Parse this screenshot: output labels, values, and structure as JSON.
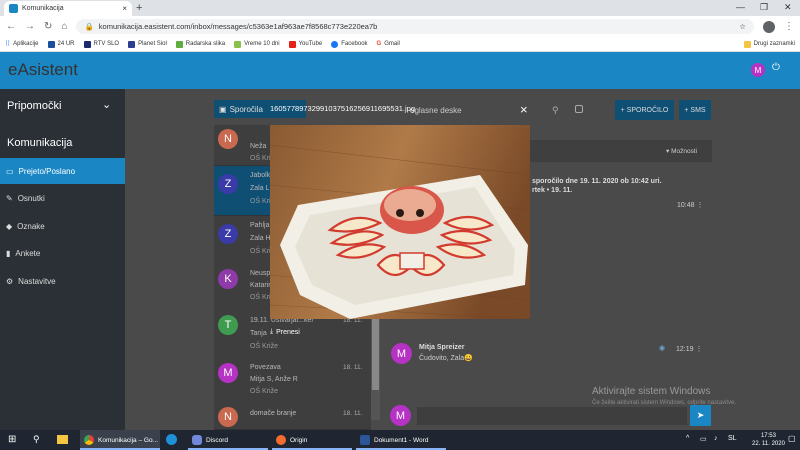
{
  "browser": {
    "tab_title": "Komunikacija",
    "new_tab": "+",
    "url": "komunikacija.easistent.com/inbox/messages/c5363e1af963ae7f8568c773e220ea7b",
    "bookmarks": [
      "Aplikacije",
      "24 UR",
      "RTV SLO",
      "Planet Siol",
      "Radarska slika",
      "Vreme 10 dni",
      "YouTube",
      "Facebook",
      "Gmail"
    ],
    "other_bookmarks": "Drugi zaznamki"
  },
  "app": {
    "logo": "eAsistent",
    "avatar_letter": "M",
    "colors": {
      "header": "#1a87c4",
      "sidebar": "#2a3036",
      "avatar": "#b532c4"
    }
  },
  "sidebar": {
    "section1": "Pripomočki",
    "section2": "Komunikacija",
    "items": [
      {
        "label": "Prejeto/Poslano",
        "icon": "inbox-icon",
        "active": true
      },
      {
        "label": "Osnutki",
        "icon": "pencil-icon"
      },
      {
        "label": "Oznake",
        "icon": "tag-icon"
      },
      {
        "label": "Ankete",
        "icon": "poll-icon"
      },
      {
        "label": "Nastavitve",
        "icon": "gear-icon"
      }
    ]
  },
  "toolbar": {
    "sporocila": "Sporočila",
    "oglasne": "oglasne deske",
    "new_message": "+ SPOROČILO",
    "sms": "+ SMS",
    "moznosti": "▾ Možnosti"
  },
  "messages": [
    {
      "letter": "N",
      "l1": "Neža",
      "l2": "",
      "l3": "OŠ Križe",
      "date": "",
      "color": "#c9694f",
      "selected": false
    },
    {
      "letter": "Z",
      "l1": "Jabolk",
      "l2": "Zala L",
      "l3": "OŠ Križe",
      "date": "",
      "color": "#3a3aa8",
      "selected": true
    },
    {
      "letter": "Z",
      "l1": "Pahlja",
      "l2": "Zala H",
      "l3": "OŠ Križe",
      "date": "",
      "color": "#3a3aa8",
      "selected": false
    },
    {
      "letter": "K",
      "l1": "Neusp",
      "l2": "Katarin",
      "l3": "OŠ Križe",
      "date": "",
      "color": "#8e3aa8",
      "selected": false
    },
    {
      "letter": "T",
      "l1": "19.11. Ustvarjal...ker",
      "l2": "Tanja",
      "l3": "OŠ Križe",
      "date": "18. 11.",
      "color": "#3e9b4f",
      "selected": false
    },
    {
      "letter": "M",
      "l1": "Povezava",
      "l2": "Mitja S, Anže R",
      "l3": "OŠ Križe",
      "date": "18. 11.",
      "color": "#b532c4",
      "selected": false
    },
    {
      "letter": "N",
      "l1": "domače branje",
      "l2": "",
      "l3": "",
      "date": "18. 11.",
      "color": "#c9694f",
      "selected": false
    }
  ],
  "message_view": {
    "meta_line1": "sporočilo dne 19. 11. 2020 ob 10:42 uri.",
    "meta_line2": "rtek • 19. 11.",
    "time1": "10:48",
    "reply_name": "Mitja Spreizer",
    "reply_text": "Čudovito, Zala😀",
    "reply_letter": "M",
    "time2": "12:19",
    "input_letter": "M"
  },
  "overlay": {
    "filename": "160577897329910375162569116955​31.jpg",
    "download": "Prenesi",
    "close": "×"
  },
  "watermark": {
    "line1": "Aktivirajte sistem Windows",
    "line2": "Če želite aktivirati sistem Windows, odprite nastavitve."
  },
  "taskbar": {
    "items": [
      {
        "label": "Komunikacija – Go...",
        "active": true
      },
      {
        "label": "Discord"
      },
      {
        "label": "Origin"
      },
      {
        "label": "Dokument1 - Word"
      }
    ],
    "time": "17:53",
    "date": "22. 11. 2020"
  }
}
